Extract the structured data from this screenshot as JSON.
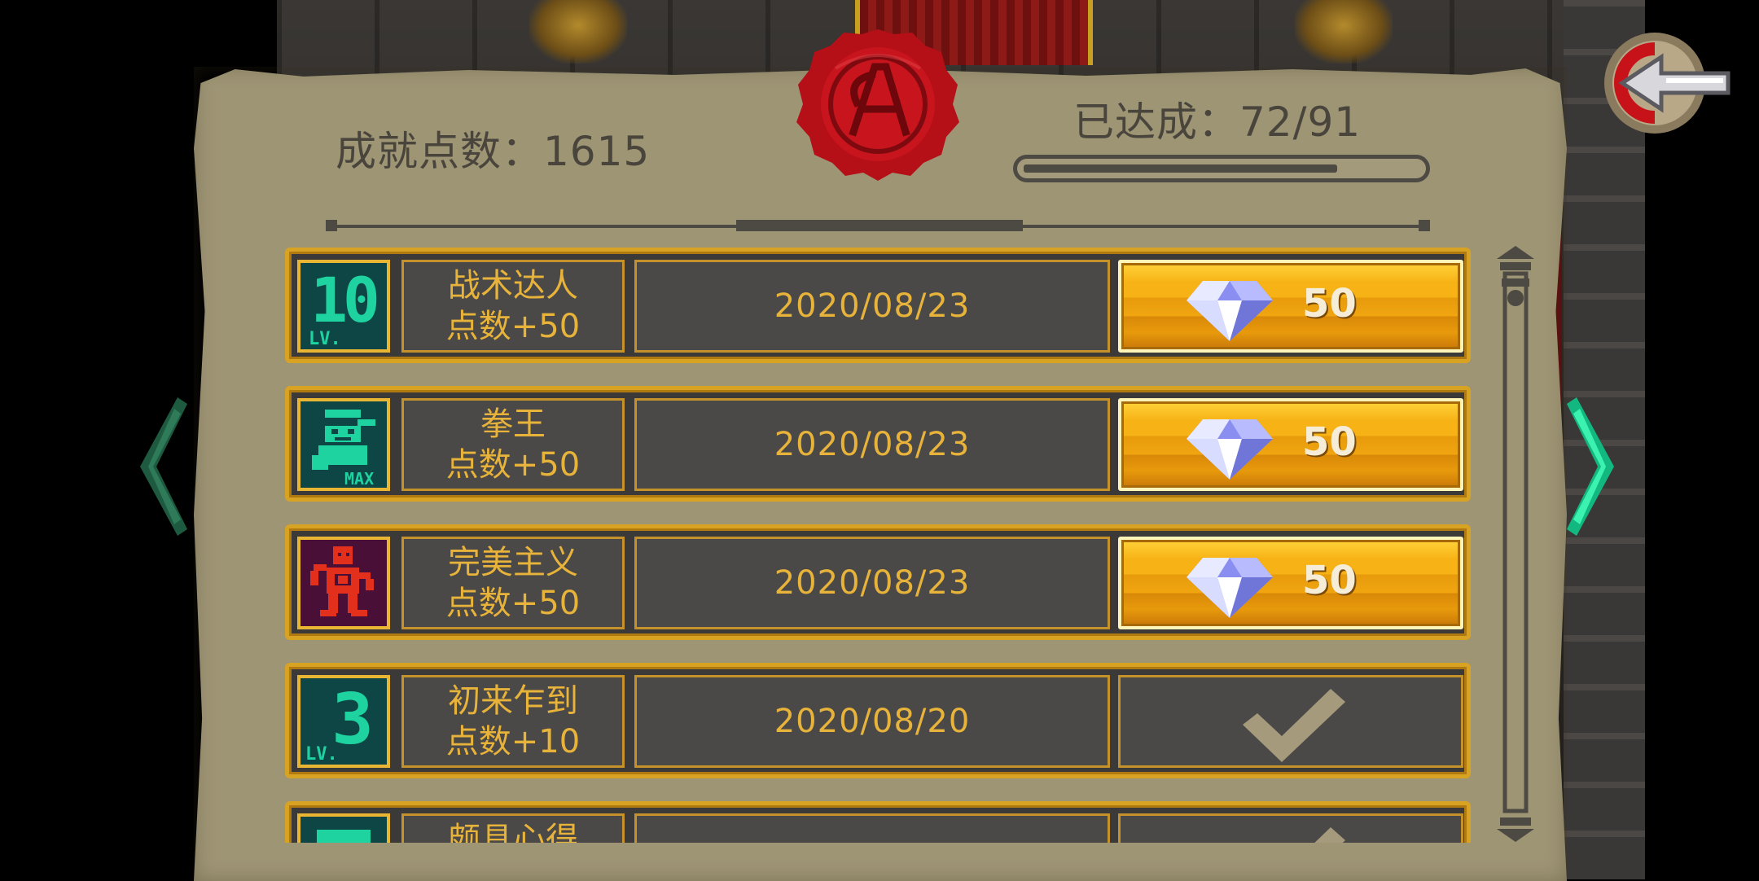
{
  "header": {
    "points_label": "成就点数：1615",
    "completed_label": "已达成：72/91",
    "progress": {
      "achieved": 72,
      "total": 91
    }
  },
  "achievements": [
    {
      "icon": "level-10-icon",
      "icon_text": "10",
      "icon_sub": "LV.",
      "name": "战术达人",
      "points": "点数+50",
      "date": "2020/08/23",
      "reward": "50",
      "status": "claimable"
    },
    {
      "icon": "boxer-icon",
      "icon_text": "",
      "icon_sub": "MAX",
      "name": "拳王",
      "points": "点数+50",
      "date": "2020/08/23",
      "reward": "50",
      "status": "claimable"
    },
    {
      "icon": "perfectionist-icon",
      "icon_text": "",
      "icon_sub": "",
      "name": "完美主义",
      "points": "点数+50",
      "date": "2020/08/23",
      "reward": "50",
      "status": "claimable"
    },
    {
      "icon": "level-3-icon",
      "icon_text": "3",
      "icon_sub": "LV.",
      "name": "初来乍到",
      "points": "点数+10",
      "date": "2020/08/20",
      "reward": "",
      "status": "claimed"
    },
    {
      "icon": "partial-icon",
      "icon_text": "",
      "icon_sub": "",
      "name": "颇具心得",
      "points": "",
      "date": "",
      "reward": "",
      "status": "claimed"
    }
  ],
  "colors": {
    "gold": "#e8b33a",
    "panel": "#9e9575",
    "teal_icon": "#1fd3a0",
    "seal_red": "#c0121a"
  }
}
